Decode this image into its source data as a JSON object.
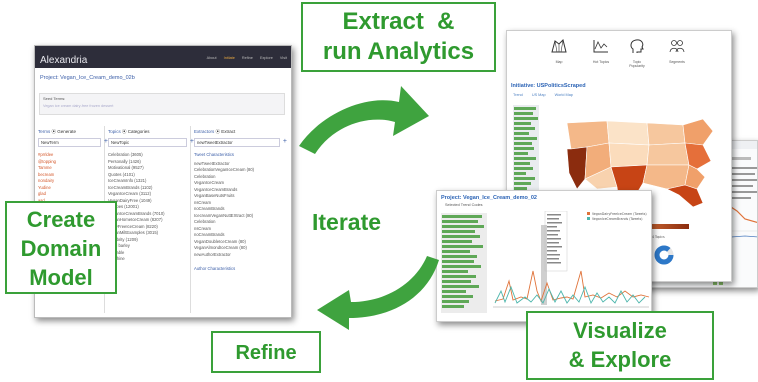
{
  "callouts": {
    "extract_line1": "Extract  &",
    "extract_line2": "run Analytics",
    "create_line1": "Create",
    "create_line2": "Domain",
    "create_line3": "Model",
    "iterate": "Iterate",
    "refine": "Refine",
    "visualize_line1": "Visualize",
    "visualize_line2": "& Explore"
  },
  "colors": {
    "callout_green": "#2f9a2f",
    "arrow_green": "#3fa33f",
    "app_titlebar": "#2d2d3a",
    "map_dark": "#8b2c0e",
    "map_light": "#fbe3c8"
  },
  "app": {
    "name": "Alexandria",
    "nav": [
      "About",
      "Initiate",
      "Refine",
      "Explore",
      "Visit"
    ],
    "nav_active_index": 1,
    "project": "Project: Vegan_Ice_Cream_demo_02b",
    "seed_label": "Seed Terms:",
    "seed_placeholder": "Vegan ice cream dairy-free frozen dessert",
    "terms": {
      "header": "Terms",
      "header_option": "Generate",
      "input": "NewTerm",
      "items": [
        "#prrldee",
        "@topping",
        "Tamme",
        "becream",
        "nondairy",
        "Yudine",
        "glad",
        "asd",
        "#vegan",
        "Agrtu",
        "Evarts",
        "Kelnts",
        "Taeor",
        "vegan",
        "#novegan",
        "coconut",
        "project",
        "vegetarian",
        "fruity"
      ]
    },
    "topics": {
      "header": "Topics",
      "header_option": "Categories",
      "input": "NewTopic",
      "items": [
        "Celebration (3605)",
        "Personally (1426)",
        "Motivational (9527)",
        "Quotes (4101)",
        "IceCreamInfo (1321)",
        "IceCreamBrands (1102)",
        "VeganIceCream (3112)",
        "VeganDairyFree (1049)",
        "Recipes (12001)",
        "VeganIceCreamBrands (7010)",
        "VeganHomeIceCream (8207)",
        "DairyFreeIceCream (8220)",
        "VeganMiltExamples (3015)",
        "Celebrity (1209)",
        "pearl barley",
        "adorable",
        "sunshine"
      ]
    },
    "extractors": {
      "header": "Extractors",
      "header_option": "Extract",
      "input": "newTweetExtractor",
      "tweet_header": "Tweet Characteristics",
      "items": [
        "newTweetExtractor",
        "CelebrationVeganIceCream (80)",
        "Celebration",
        "VeganIceCream",
        "VeganIceCreamBrands",
        "VeganBaseNutsFruits",
        "nsCream",
        "noCreamBrands",
        "IcecreamVeganNuttEXtract (80)",
        "Celebration",
        "nsCream",
        "noCreamBrands",
        "VeganDoubleIceCream (80)",
        "VeganAlmondIceCream (80)",
        "newAuthorExtractor"
      ],
      "author_header": "Author Characteristics"
    }
  },
  "map_view": {
    "icons": [
      {
        "label": "Map"
      },
      {
        "label": "Hot Topics"
      },
      {
        "label": "Topic Popularity"
      },
      {
        "label": "Segments"
      }
    ],
    "title": "Initiative: USPoliticsScraped",
    "tabs": [
      "Trend",
      "US Map",
      "World Map"
    ],
    "legend_label": "# of profiles in domain",
    "donut_labels": [
      "1 Topic",
      "2 Topics",
      "3 Topics",
      "4 Topics"
    ],
    "donut_colors": [
      "#d9534f",
      "#2d78c8",
      "#2d78c8",
      "#2d78c8"
    ]
  },
  "chart_view": {
    "title": "Project: Vegan_Ice_Cream_demo_02",
    "filter_label": "Selected Trend Codes",
    "legend": [
      "VeganDairyFreeIceCream (Tweets)",
      "VeganIceCreamBrands (Tweets)"
    ]
  }
}
